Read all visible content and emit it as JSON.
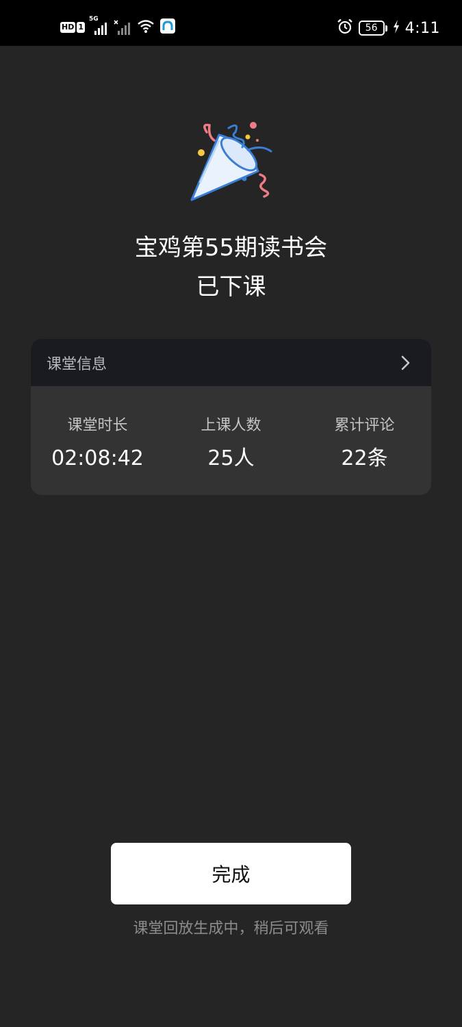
{
  "status_bar": {
    "hd_label": "HD",
    "sim_label": "1",
    "network_label": "5G",
    "battery_level": "56",
    "time": "4:11"
  },
  "page": {
    "title_line1": "宝鸡第55期读书会",
    "title_line2": "已下课"
  },
  "class_info": {
    "header_label": "课堂信息",
    "stats": [
      {
        "label": "课堂时长",
        "value": "02:08:42"
      },
      {
        "label": "上课人数",
        "value": "25人"
      },
      {
        "label": "累计评论",
        "value": "22条"
      }
    ]
  },
  "actions": {
    "done_label": "完成",
    "note": "课堂回放生成中，稍后可观看"
  },
  "colors": {
    "background": "#252525",
    "status_bar": "#000000",
    "card": "#333333",
    "card_header": "#191b21",
    "button": "#ffffff",
    "accent_blue": "#3a7fd5",
    "accent_pink": "#f07a86",
    "accent_yellow": "#f5c842"
  },
  "icons": {
    "status_left": [
      "hd-icon",
      "signal-5g-icon",
      "signal-no-service-icon",
      "wifi-icon",
      "app-notification-icon"
    ],
    "status_right": [
      "alarm-icon",
      "battery-icon",
      "charging-icon"
    ],
    "hero": "party-popper-icon",
    "card_header": "chevron-right-icon"
  }
}
